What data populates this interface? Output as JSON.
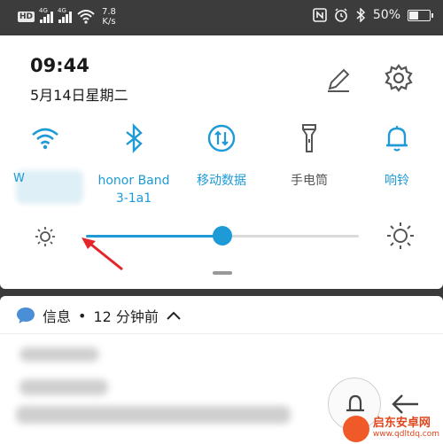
{
  "status_bar": {
    "hd_badge": "HD",
    "signal1_gen": "4G",
    "signal2_gen": "4G",
    "net_speed_value": "7.8",
    "net_speed_unit": "K/s",
    "battery_percent": "50%",
    "battery_level": 0.5,
    "icons": [
      "hd-icon",
      "signal-icon",
      "signal-icon",
      "wifi-icon",
      "nfc-icon",
      "alarm-icon",
      "bluetooth-icon",
      "battery-icon"
    ]
  },
  "panel": {
    "time": "09:44",
    "date": "5月14日星期二",
    "edit_icon": "pencil-icon",
    "settings_icon": "gear-icon",
    "tiles": [
      {
        "name": "wifi",
        "icon": "wifi-icon",
        "label": "W",
        "active": true
      },
      {
        "name": "bluetooth",
        "icon": "bluetooth-icon",
        "label": "honor Band 3-1a1",
        "active": true
      },
      {
        "name": "mobile-data",
        "icon": "mobile-data-icon",
        "label": "移动数据",
        "active": true
      },
      {
        "name": "flashlight",
        "icon": "flashlight-icon",
        "label": "手电筒",
        "active": false
      },
      {
        "name": "ring",
        "icon": "bell-icon",
        "label": "响铃",
        "active": true
      }
    ],
    "brightness_level": 0.5,
    "accent_color": "#1e9ad7",
    "annotation_color": "#e5252a"
  },
  "notification": {
    "app": "信息",
    "time_ago": "12 分钟前",
    "separator": "•",
    "expand_icon": "chevron-up-icon",
    "app_icon": "message-icon"
  },
  "watermark": {
    "title": "启东安卓网",
    "url": "www.qdltdq.com"
  }
}
